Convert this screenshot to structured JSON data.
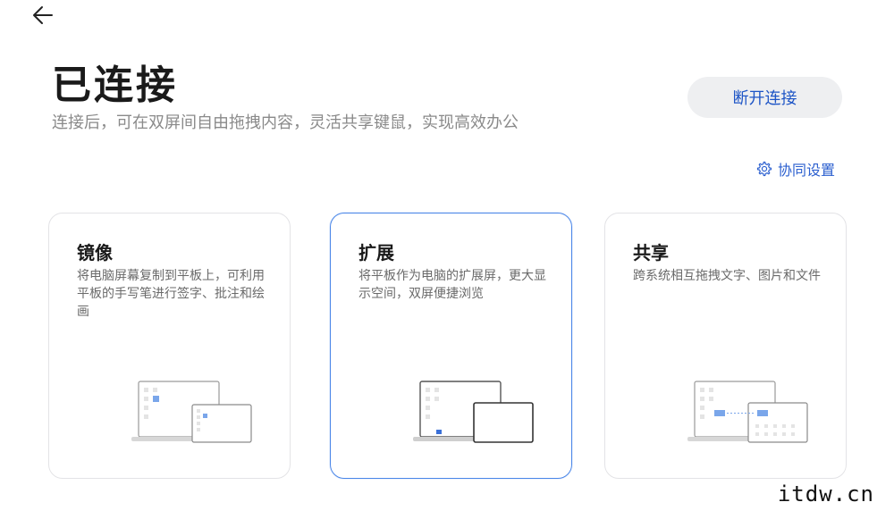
{
  "header": {
    "title": "已连接",
    "subtitle": "连接后，可在双屏间自由拖拽内容，灵活共享键鼠，实现高效办公",
    "disconnect_label": "断开连接",
    "settings_label": "协同设置"
  },
  "modes": [
    {
      "title": "镜像",
      "description": "将电脑屏幕复制到平板上，可利用平板的手写笔进行签字、批注和绘画"
    },
    {
      "title": "扩展",
      "description": "将平板作为电脑的扩展屏，更大显示空间，双屏便捷浏览",
      "selected": true
    },
    {
      "title": "共享",
      "description": "跨系统相互拖拽文字、图片和文件"
    }
  ],
  "watermark": "itdw.cn",
  "colors": {
    "accent": "#2b5fcf",
    "selected_border": "#4a86e8",
    "button_bg": "#eeeff1"
  },
  "icons": {
    "back": "arrow-left-icon",
    "settings": "gear-icon"
  }
}
